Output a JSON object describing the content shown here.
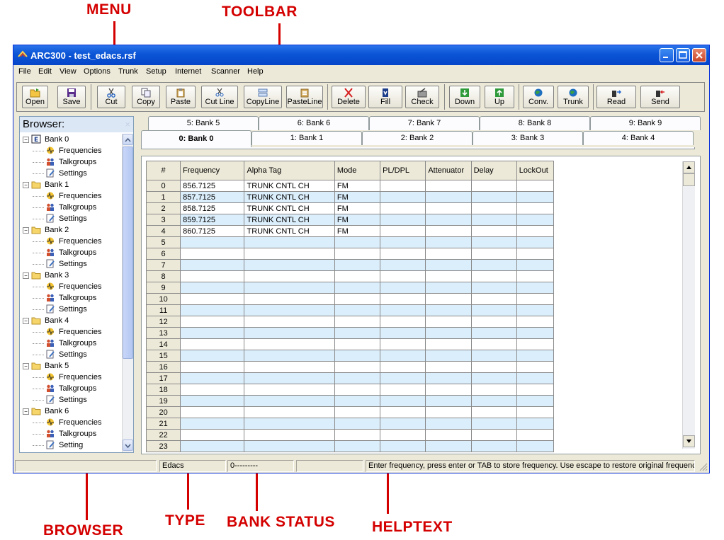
{
  "annotations": {
    "menu": "MENU",
    "toolbar": "TOOLBAR",
    "browser": "BROWSER",
    "type": "TYPE",
    "bank_status": "BANK STATUS",
    "helptext": "HELPTEXT"
  },
  "window": {
    "title": "ARC300 - test_edacs.rsf"
  },
  "menu": [
    "File",
    "Edit",
    "View",
    "Options",
    "Trunk",
    "Setup",
    "Internet",
    "Scanner",
    "Help"
  ],
  "toolbar": {
    "buttons": [
      "Open",
      "Save",
      "Cut",
      "Copy",
      "Paste",
      "Cut Line",
      "CopyLine",
      "PasteLine",
      "Delete",
      "Fill",
      "Check",
      "Down",
      "Up",
      "Conv.",
      "Trunk",
      "Read",
      "Send"
    ]
  },
  "browser": {
    "header": "Browser:",
    "close_glyph": "×",
    "banks": [
      "Bank 0",
      "Bank 1",
      "Bank 2",
      "Bank 3",
      "Bank 4",
      "Bank 5",
      "Bank 6"
    ],
    "children": [
      "Frequencies",
      "Talkgroups",
      "Settings"
    ],
    "last_child_label": "Setting"
  },
  "tabs": {
    "back_row": [
      "5: Bank 5",
      "6: Bank 6",
      "7: Bank 7",
      "8: Bank 8",
      "9: Bank 9"
    ],
    "front_row": [
      "0: Bank 0",
      "1: Bank 1",
      "2: Bank 2",
      "3: Bank 3",
      "4: Bank 4"
    ],
    "active": "0: Bank 0"
  },
  "grid": {
    "columns": [
      "#",
      "Frequency",
      "Alpha Tag",
      "Mode",
      "PL/DPL",
      "Attenuator",
      "Delay",
      "LockOut"
    ],
    "rows": [
      [
        "0",
        "856.7125",
        "TRUNK CNTL CH",
        "FM"
      ],
      [
        "1",
        "857.7125",
        "TRUNK CNTL CH",
        "FM"
      ],
      [
        "2",
        "858.7125",
        "TRUNK CNTL CH",
        "FM"
      ],
      [
        "3",
        "859.7125",
        "TRUNK CNTL CH",
        "FM"
      ],
      [
        "4",
        "860.7125",
        "TRUNK CNTL CH",
        "FM"
      ],
      [
        "5"
      ],
      [
        "6"
      ],
      [
        "7"
      ],
      [
        "8"
      ],
      [
        "9"
      ],
      [
        "10"
      ],
      [
        "11"
      ],
      [
        "12"
      ],
      [
        "13"
      ],
      [
        "14"
      ],
      [
        "15"
      ],
      [
        "16"
      ],
      [
        "17"
      ],
      [
        "18"
      ],
      [
        "19"
      ],
      [
        "20"
      ],
      [
        "21"
      ],
      [
        "22"
      ],
      [
        "23"
      ]
    ]
  },
  "status": {
    "type": "Edacs",
    "bank_status": "0---------",
    "helptext": "Enter frequency, press enter or TAB to store frequency. Use escape to restore original frequency."
  },
  "colors": {
    "callout": "#d40000",
    "titlebar": "#0a55d6",
    "row_alt": "#dbeefc",
    "window_bg": "#ece9d8"
  }
}
